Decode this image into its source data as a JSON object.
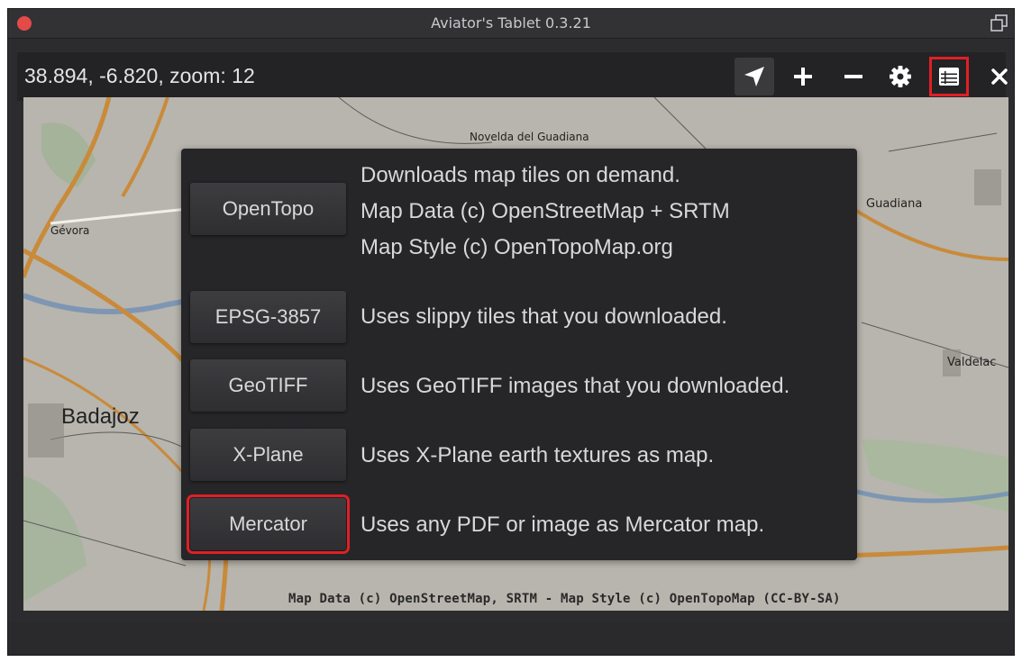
{
  "window": {
    "title": "Aviator's Tablet  0.3.21"
  },
  "toolbar": {
    "coords": "38.894, -6.820, zoom: 12",
    "buttons": [
      {
        "name": "locate",
        "icon": "navigation-arrow-icon"
      },
      {
        "name": "zoom-in",
        "icon": "plus-icon"
      },
      {
        "name": "zoom-out",
        "icon": "minus-icon"
      },
      {
        "name": "settings",
        "icon": "gear-icon"
      },
      {
        "name": "layers",
        "icon": "list-table-icon",
        "highlighted": true
      },
      {
        "name": "close",
        "icon": "close-icon"
      }
    ]
  },
  "map": {
    "places": [
      "Novelda del Guadiana",
      "Gévora",
      "Badajoz",
      "Guadiana",
      "Valdelac"
    ],
    "attribution": "Map Data (c) OpenStreetMap, SRTM - Map Style (c) OpenTopoMap (CC-BY-SA)"
  },
  "sources": [
    {
      "label": "OpenTopo",
      "description": [
        "Downloads map tiles on demand.",
        "Map Data (c) OpenStreetMap + SRTM",
        "Map Style (c) OpenTopoMap.org"
      ]
    },
    {
      "label": "EPSG-3857",
      "description": [
        "Uses slippy tiles that you downloaded."
      ]
    },
    {
      "label": "GeoTIFF",
      "description": [
        "Uses GeoTIFF images that you downloaded."
      ]
    },
    {
      "label": "X-Plane",
      "description": [
        "Uses X-Plane earth textures as map."
      ]
    },
    {
      "label": "Mercator",
      "description": [
        "Uses any PDF or image as Mercator map."
      ],
      "highlighted": true
    }
  ],
  "colors": {
    "highlight": "#e01f26",
    "close_dot": "#e34b48"
  }
}
